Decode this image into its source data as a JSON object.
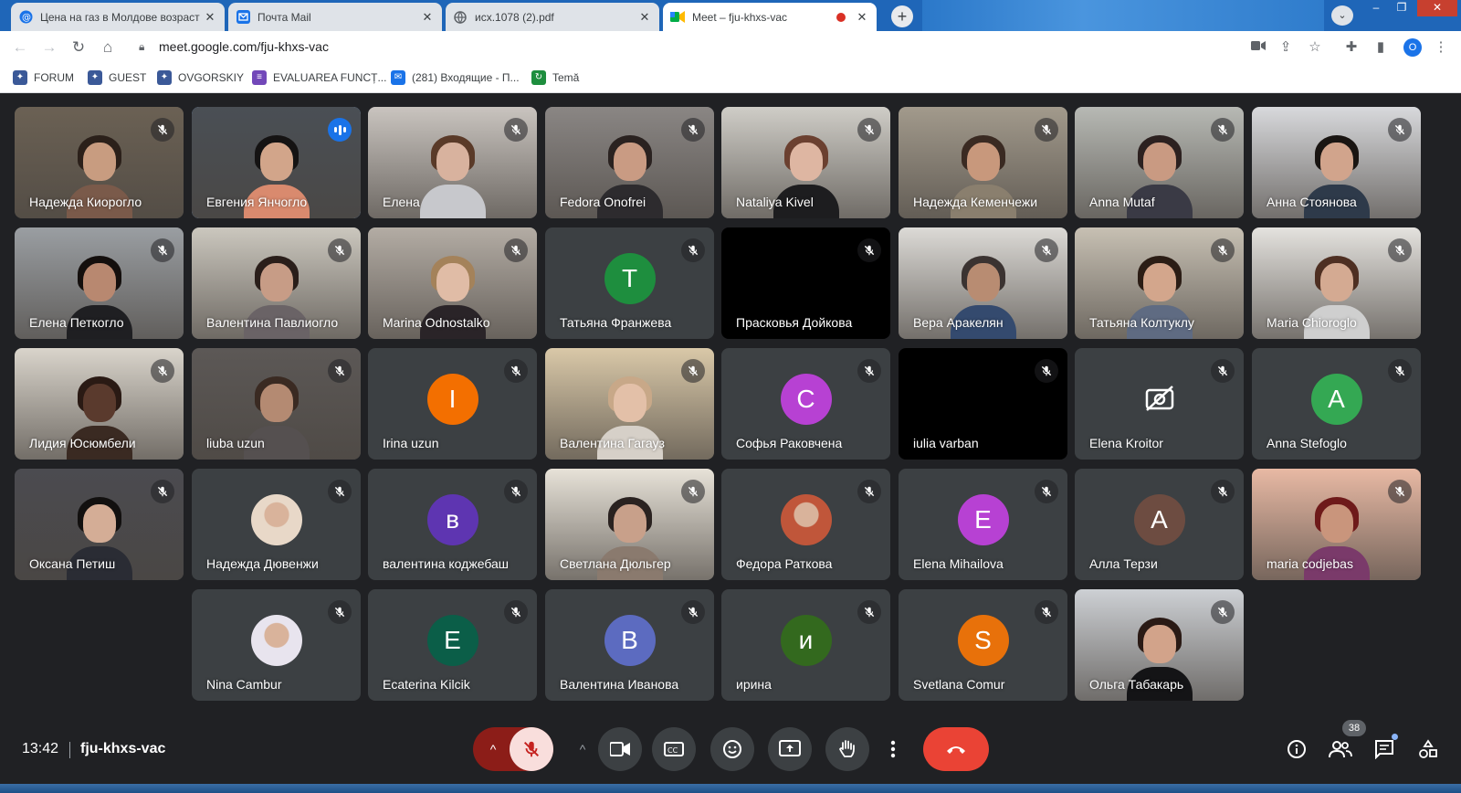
{
  "browser": {
    "tabs": [
      {
        "title": "Цена на газ в Молдове возраст",
        "favicon": "at-mail-icon",
        "active": false
      },
      {
        "title": "Почта Mail",
        "favicon": "mail-icon",
        "active": false
      },
      {
        "title": "исх.1078 (2).pdf",
        "favicon": "globe-icon",
        "active": false
      },
      {
        "title": "Meet – fju-khxs-vac",
        "favicon": "meet-icon",
        "active": true,
        "recording": true
      }
    ],
    "url": "meet.google.com/fju-khxs-vac",
    "profile_initial": "O",
    "bookmarks": [
      {
        "label": "FORUM",
        "icon": "puzzle-icon",
        "color": "#3b5998"
      },
      {
        "label": "GUEST",
        "icon": "puzzle-icon",
        "color": "#3b5998"
      },
      {
        "label": "OVGORSKIY",
        "icon": "puzzle-icon",
        "color": "#3b5998"
      },
      {
        "label": "EVALUAREA FUNCȚ...",
        "icon": "form-icon",
        "color": "#7248b9"
      },
      {
        "label": "(281) Входящие - П...",
        "icon": "mail-icon",
        "color": "#1a73e8"
      },
      {
        "label": "Temă",
        "icon": "classroom-icon",
        "color": "#1e8e3e"
      }
    ]
  },
  "meeting": {
    "time": "13:42",
    "code": "fju-khxs-vac",
    "participant_count": "38",
    "accent_colors": {
      "leave": "#ea4335",
      "mic_off": "#f9dedc",
      "speaking": "#8ab4f8"
    }
  },
  "participants": [
    {
      "name": "Надежда Киорогло",
      "type": "video",
      "bg": "#6b6154",
      "skin": "#c89c80",
      "hair": "#2b201a",
      "shirt": "#7a5a4a"
    },
    {
      "name": "Евгения Янчогло",
      "type": "video",
      "speaking": true,
      "bg": "#4a4f55",
      "skin": "#d2a58a",
      "hair": "#151313",
      "shirt": "#d98a6e"
    },
    {
      "name": "Елена",
      "type": "video",
      "bg": "#c9c4bf",
      "skin": "#d8b29e",
      "hair": "#5a3a28",
      "shirt": "#c7c8cc"
    },
    {
      "name": "Fedora Onofrei",
      "type": "video",
      "bg": "#8a8684",
      "skin": "#c99b83",
      "hair": "#2a2220",
      "shirt": "#2d2b2e"
    },
    {
      "name": "Nataliya Kivel",
      "type": "video",
      "bg": "#cfcdc7",
      "skin": "#deb6a2",
      "hair": "#6b4030",
      "shirt": "#1d1d1f"
    },
    {
      "name": "Надежда Кеменчежи",
      "type": "video",
      "bg": "#a29a8c",
      "skin": "#c8987c",
      "hair": "#3a2a22",
      "shirt": "#8a7f6e"
    },
    {
      "name": "Anna Mutaf",
      "type": "video",
      "bg": "#b7b9b4",
      "skin": "#c99a82",
      "hair": "#2c2120",
      "shirt": "#3a3a45"
    },
    {
      "name": "Анна Стоянова",
      "type": "video",
      "bg": "#d8d9dc",
      "skin": "#d1a48c",
      "hair": "#1a1512",
      "shirt": "#2e3a4a"
    },
    {
      "name": "Елена Петкогло",
      "type": "video",
      "bg": "#9a9ea2",
      "skin": "#b88870",
      "hair": "#140f0d",
      "shirt": "#1f1f22"
    },
    {
      "name": "Валентина Павлиогло",
      "type": "video",
      "bg": "#cbc7be",
      "skin": "#c79c86",
      "hair": "#2a1e1a",
      "shirt": "#6a6366"
    },
    {
      "name": "Marina Odnostalko",
      "type": "video",
      "bg": "#b3aca4",
      "skin": "#e0bca6",
      "hair": "#a4825a",
      "shirt": "#2a2428"
    },
    {
      "name": "Татьяна Франжева",
      "type": "avatar",
      "letter": "T",
      "color": "#1e8e3e"
    },
    {
      "name": "Прасковья Дойкова",
      "type": "dark"
    },
    {
      "name": "Вера Аракелян",
      "type": "video",
      "bg": "#dcdad6",
      "skin": "#b88c72",
      "hair": "#3b3331",
      "shirt": "#344a6e"
    },
    {
      "name": "Татьяна Колтуклу",
      "type": "video",
      "bg": "#c7c0b3",
      "skin": "#d3a68c",
      "hair": "#2b1d15",
      "shirt": "#5f6b82"
    },
    {
      "name": "Maria Chioroglo",
      "type": "video",
      "bg": "#e4e2de",
      "skin": "#d4aa92",
      "hair": "#4e2f22",
      "shirt": "#cfcfcf"
    },
    {
      "name": "Лидия Юсюмбели",
      "type": "video",
      "bg": "#d9d4cb",
      "skin": "#5a3a2d",
      "hair": "#2a1a14",
      "shirt": "#3a2a22"
    },
    {
      "name": "liuba uzun",
      "type": "video",
      "bg": "#5c5856",
      "skin": "#b48a72",
      "hair": "#3a2a22",
      "shirt": "#555050"
    },
    {
      "name": "Irina uzun",
      "type": "avatar",
      "letter": "I",
      "color": "#f36f00"
    },
    {
      "name": "Валентина Гагауз",
      "type": "video",
      "bg": "#d9c8a8",
      "skin": "#e3c0a8",
      "hair": "#c8a888",
      "shirt": "#d6d0c8"
    },
    {
      "name": "Софья Раковчена",
      "type": "avatar",
      "letter": "C",
      "color": "#b741d3"
    },
    {
      "name": "iulia varban",
      "type": "dark"
    },
    {
      "name": "Elena Kroitor",
      "type": "camoff"
    },
    {
      "name": "Anna Stefoglo",
      "type": "avatar",
      "letter": "A",
      "color": "#34a853"
    },
    {
      "name": "Оксана Петиш",
      "type": "video",
      "bg": "#4b4b50",
      "skin": "#d4ad96",
      "hair": "#12100f",
      "shirt": "#2a2c34"
    },
    {
      "name": "Надежда Дювенжи",
      "type": "photo",
      "color": "#e8d8c8"
    },
    {
      "name": "валентина коджебаш",
      "type": "avatar",
      "letter": "в",
      "color": "#5e35b1"
    },
    {
      "name": "Светлана Дюльгер",
      "type": "video",
      "bg": "#e7e2d8",
      "skin": "#c8a08a",
      "hair": "#2a2220",
      "shirt": "#8a7a6e"
    },
    {
      "name": "Федора Раткова",
      "type": "photo",
      "color": "#c0563a"
    },
    {
      "name": "Elena Mihailova",
      "type": "avatar",
      "letter": "E",
      "color": "#b741d3"
    },
    {
      "name": "Алла Терзи",
      "type": "avatar",
      "letter": "А",
      "color": "#6d4c41"
    },
    {
      "name": "maria codjebas",
      "type": "video",
      "bg": "#e8b9a4",
      "skin": "#c9957c",
      "hair": "#6e1a1a",
      "shirt": "#7a3a6a"
    },
    {
      "name": "Nina Cambur",
      "type": "photo",
      "color": "#e8e4ee"
    },
    {
      "name": "Ecaterina Kilcik",
      "type": "avatar",
      "letter": "E",
      "color": "#0b5e48"
    },
    {
      "name": "Валентина Иванова",
      "type": "avatar",
      "letter": "В",
      "color": "#5c6bc0"
    },
    {
      "name": "ирина",
      "type": "avatar",
      "letter": "и",
      "color": "#33691e"
    },
    {
      "name": "Svetlana Comur",
      "type": "avatar",
      "letter": "S",
      "color": "#e8710a"
    },
    {
      "name": "Ольга Табакарь",
      "type": "video",
      "bg": "#cdd0d4",
      "skin": "#d2a38a",
      "hair": "#2a1a15",
      "shirt": "#141416"
    }
  ]
}
